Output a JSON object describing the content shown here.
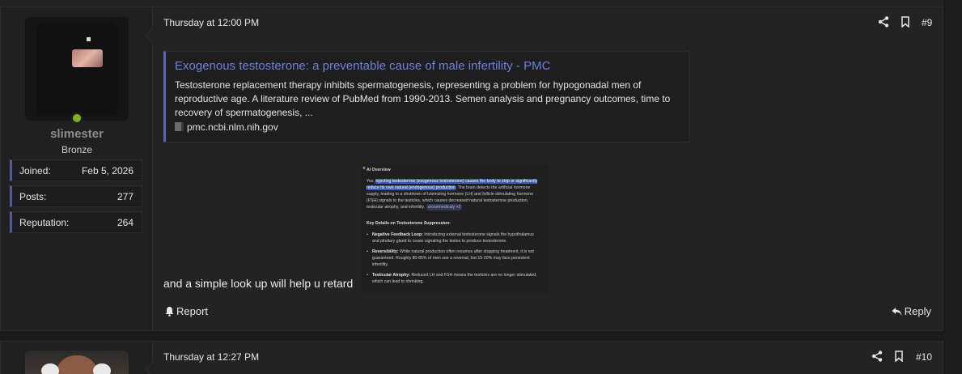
{
  "posts": [
    {
      "user": {
        "name": "slimester",
        "title": "Bronze",
        "online": true,
        "stats": [
          {
            "label": "Joined:",
            "value": "Feb 5, 2026"
          },
          {
            "label": "Posts:",
            "value": "277"
          },
          {
            "label": "Reputation:",
            "value": "264"
          }
        ]
      },
      "date": "Thursday at 12:00 PM",
      "number": "#9",
      "embed": {
        "title": "Exogenous testosterone: a preventable cause of male infertility - PMC",
        "description": "Testosterone replacement therapy inhibits spermatogenesis, representing a problem for hypogonadal men of reproductive age. A literature review of PubMed from 1990-2013. Semen analysis and pregnancy outcomes, time to recovery of spermatogenesis, ...",
        "domain": "pmc.ncbi.nlm.nih.gov"
      },
      "text": "and a simple look up will help u retard",
      "ai_overview": {
        "heading": "AI Overview",
        "intro_prefix": "Yes, ",
        "intro_highlight": "injecting testosterone (exogenous testosterone) causes the body to stop or significantly reduce its own natural (endogenous) production",
        "intro_rest": ". The brain detects the artificial hormone supply, leading to a shutdown of luteinizing hormone (LH) and follicle-stimulating hormone (FSH) signals to the testicles, which causes decreased natural testosterone production, testicular atrophy, and infertility.",
        "chip": "urosemedicaly +2",
        "subheading": "Key Details on Testosterone Suppression:",
        "bullets": [
          {
            "term": "Negative Feedback Loop:",
            "text": "Introducing external testosterone signals the hypothalamus and pituitary gland to cease signaling the testes to produce testosterone."
          },
          {
            "term": "Reversibility:",
            "text": "While natural production often resumes after stopping treatment, it is not guaranteed. Roughly 80-85% of men see a reversal, but 15-20% may face persistent infertility."
          },
          {
            "term": "Testicular Atrophy:",
            "text": "Reduced LH and FSH means the testicles are no longer stimulated, which can lead to shrinking."
          }
        ]
      },
      "actions": {
        "report": "Report",
        "reply": "Reply"
      }
    },
    {
      "date": "Thursday at 12:27 PM",
      "number": "#10"
    }
  ],
  "colors": {
    "accent": "#5a67b0",
    "link": "#6a82d8",
    "online": "#7cb518"
  },
  "icons": [
    "share-icon",
    "bookmark-icon",
    "bell-icon",
    "reply-icon",
    "link-icon",
    "sparkle-icon"
  ]
}
